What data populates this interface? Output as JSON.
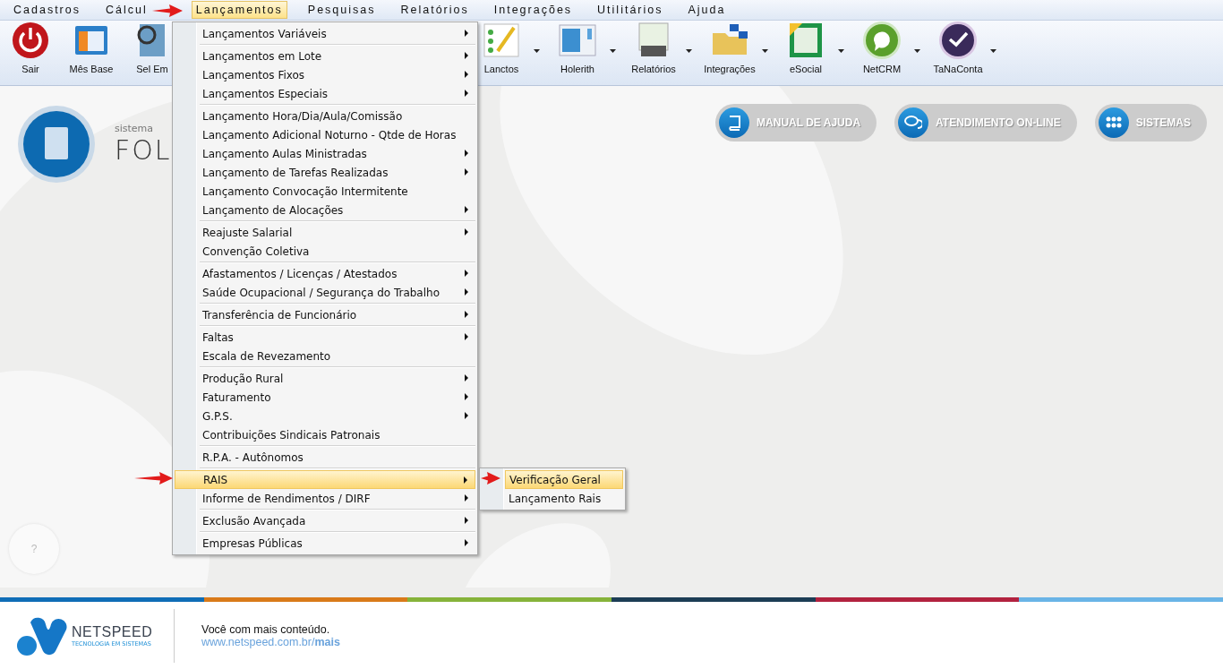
{
  "menu_bar": [
    {
      "label": "Cadastros",
      "selected": false
    },
    {
      "label": "Cálcul",
      "selected": false
    },
    {
      "label": "Lançamentos",
      "selected": true
    },
    {
      "label": "Pesquisas",
      "selected": false
    },
    {
      "label": "Relatórios",
      "selected": false
    },
    {
      "label": "Integrações",
      "selected": false
    },
    {
      "label": "Utilitários",
      "selected": false
    },
    {
      "label": "Ajuda",
      "selected": false
    }
  ],
  "toolbar_left": [
    {
      "label": "Sair",
      "dropdown": false
    },
    {
      "label": "Mês Base",
      "dropdown": false
    },
    {
      "label": "Sel Em",
      "dropdown": false
    }
  ],
  "toolbar_right": [
    {
      "label": "Lanctos",
      "dropdown": true
    },
    {
      "label": "Holerith",
      "dropdown": true
    },
    {
      "label": "Relatórios",
      "dropdown": true
    },
    {
      "label": "Integrações",
      "dropdown": true
    },
    {
      "label": "eSocial",
      "dropdown": true
    },
    {
      "label": "NetCRM",
      "dropdown": true
    },
    {
      "label": "TaNaConta",
      "dropdown": true
    }
  ],
  "brand": {
    "caption": "sistema",
    "name": "FOL"
  },
  "header_buttons": [
    {
      "label": "MANUAL DE AJUDA"
    },
    {
      "label": "ATENDIMENTO ON-LINE"
    },
    {
      "label": "SISTEMAS"
    }
  ],
  "help_button": {
    "label": "?"
  },
  "dropdown_menu": [
    [
      {
        "label": "Lançamentos Variáveis",
        "submenu": true,
        "selected": false
      }
    ],
    [
      {
        "label": "Lançamentos em Lote",
        "submenu": true,
        "selected": false
      },
      {
        "label": "Lançamentos Fixos",
        "submenu": true,
        "selected": false
      },
      {
        "label": "Lançamentos Especiais",
        "submenu": true,
        "selected": false
      }
    ],
    [
      {
        "label": "Lançamento Hora/Dia/Aula/Comissão",
        "submenu": false,
        "selected": false
      },
      {
        "label": "Lançamento Adicional Noturno - Qtde de Horas",
        "submenu": false,
        "selected": false
      },
      {
        "label": "Lançamento Aulas Ministradas",
        "submenu": true,
        "selected": false
      },
      {
        "label": "Lançamento de Tarefas Realizadas",
        "submenu": true,
        "selected": false
      },
      {
        "label": "Lançamento Convocação Intermitente",
        "submenu": false,
        "selected": false
      },
      {
        "label": "Lançamento de Alocações",
        "submenu": true,
        "selected": false
      }
    ],
    [
      {
        "label": "Reajuste Salarial",
        "submenu": true,
        "selected": false
      },
      {
        "label": "Convenção Coletiva",
        "submenu": false,
        "selected": false
      }
    ],
    [
      {
        "label": "Afastamentos / Licenças / Atestados",
        "submenu": true,
        "selected": false
      },
      {
        "label": "Saúde Ocupacional / Segurança do Trabalho",
        "submenu": true,
        "selected": false
      }
    ],
    [
      {
        "label": "Transferência de Funcionário",
        "submenu": true,
        "selected": false
      }
    ],
    [
      {
        "label": "Faltas",
        "submenu": true,
        "selected": false
      },
      {
        "label": "Escala de Revezamento",
        "submenu": false,
        "selected": false
      }
    ],
    [
      {
        "label": "Produção Rural",
        "submenu": true,
        "selected": false
      },
      {
        "label": "Faturamento",
        "submenu": true,
        "selected": false
      },
      {
        "label": "G.P.S.",
        "submenu": true,
        "selected": false
      },
      {
        "label": "Contribuições Sindicais Patronais",
        "submenu": false,
        "selected": false
      }
    ],
    [
      {
        "label": "R.P.A. - Autônomos",
        "submenu": false,
        "selected": false
      }
    ],
    [
      {
        "label": "RAIS",
        "submenu": true,
        "selected": true
      },
      {
        "label": "Informe de Rendimentos / DIRF",
        "submenu": true,
        "selected": false
      }
    ],
    [
      {
        "label": "Exclusão Avançada",
        "submenu": true,
        "selected": false
      }
    ],
    [
      {
        "label": "Empresas Públicas",
        "submenu": true,
        "selected": false
      }
    ]
  ],
  "submenu": [
    {
      "label": "Verificação Geral",
      "selected": true
    },
    {
      "label": "Lançamento Rais",
      "selected": false
    }
  ],
  "footer": {
    "company": "NETSPEED",
    "tagline": "TECNOLOGIA EM SISTEMAS",
    "message": "Você com mais conteúdo.",
    "link": "www.netspeed.com.br/**mais**"
  }
}
